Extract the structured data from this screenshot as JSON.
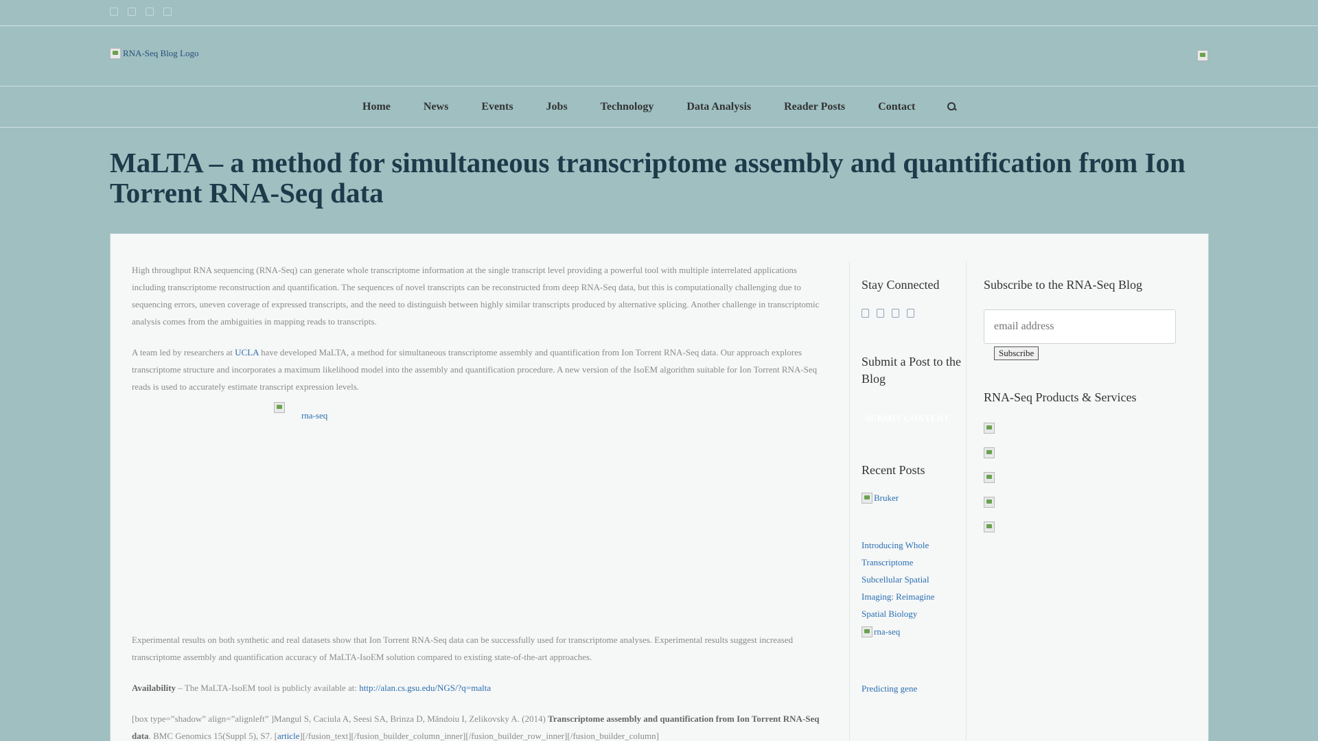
{
  "header": {
    "logo_alt": "RNA-Seq Blog Logo",
    "social_icons": [
      "facebook-icon",
      "twitter-icon",
      "linkedin-icon",
      "rss-icon"
    ]
  },
  "nav": {
    "items": [
      "Home",
      "News",
      "Events",
      "Jobs",
      "Technology",
      "Data Analysis",
      "Reader Posts",
      "Contact"
    ]
  },
  "page": {
    "title": "MaLTA – a method for simultaneous transcriptome assembly and quantification from Ion Torrent RNA-Seq data"
  },
  "article": {
    "p1": "High throughput RNA sequencing (RNA-Seq) can generate whole transcriptome information at the single transcript level providing a powerful tool with multiple interrelated applications including transcriptome reconstruction and quantification. The sequences of novel transcripts can be reconstructed from deep RNA-Seq data, but this is computationally challenging due to sequencing errors, uneven coverage of expressed transcripts, and the need to distinguish between highly similar transcripts produced by alternative splicing. Another challenge in transcriptomic analysis comes from the ambiguities in mapping reads to transcripts.",
    "p2_before": "A team led by researchers at ",
    "p2_link": "UCLA",
    "p2_after": " have developed MaLTA, a method for simultaneous transcriptome assembly and quantification from Ion Torrent RNA-Seq data. Our approach explores transcriptome structure and incorporates a maximum likelihood model into the assembly and quantification procedure. A new version of the IsoEM algorithm suitable for Ion Torrent RNA-Seq reads is used to accurately estimate transcript expression levels.",
    "figure_alt": "rna-seq",
    "p3": "Experimental results on both synthetic and real datasets show that Ion Torrent RNA-Seq data can be successfully used for transcriptome analyses. Experimental results suggest increased transcriptome assembly and quantification accuracy of MaLTA-IsoEM solution compared to existing state-of-the-art approaches.",
    "availability_label": "Availability",
    "availability_text": " – The MaLTA-IsoEM tool is publicly available at: ",
    "availability_link": "http://alan.cs.gsu.edu/NGS/?q=malta",
    "citation_before": "[box type=”shadow” align=”alignleft” ]Mangul S, Caciula A, Seesi SA, Brinza D, Măndoiu I, Zelikovsky A. (2014) ",
    "citation_bold": "Transcriptome assembly and quantification from Ion Torrent RNA-Seq data",
    "citation_after": ". BMC Genomics 15(Suppl 5), S7. [",
    "citation_link": "article",
    "citation_tail": "][/fusion_text][/fusion_builder_column_inner][/fusion_builder_row_inner][/fusion_builder_column]"
  },
  "sidebar_mid": {
    "stay_connected": "Stay Connected",
    "social_icons": [
      "facebook-icon",
      "twitter-icon",
      "linkedin-icon",
      "rss-icon"
    ],
    "submit_title": "Submit a Post to the Blog",
    "submit_button": "SUBMIT CONTENT",
    "recent_title": "Recent Posts",
    "recent": [
      {
        "img_alt": "Bruker",
        "title": "Introducing Whole Transcriptome Subcellular Spatial Imaging: Reimagine Spatial Biology"
      },
      {
        "img_alt": "rna-seq",
        "title": "Predicting gene"
      }
    ]
  },
  "sidebar_right": {
    "subscribe_title": "Subscribe to the RNA-Seq Blog",
    "email_placeholder": "email address",
    "subscribe_button": "Subscribe",
    "products_title": "RNA-Seq Products & Services"
  }
}
